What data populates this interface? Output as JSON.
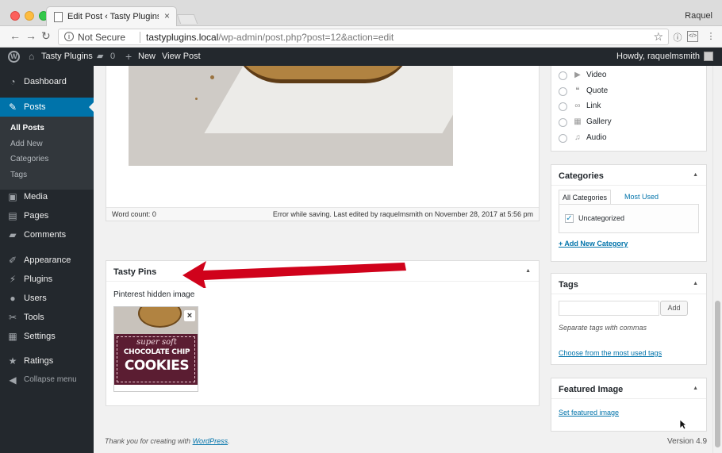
{
  "browser": {
    "tab_title": "Edit Post ‹ Tasty Plugins — Wo",
    "tab_close": "×",
    "profile_name": "Raquel",
    "security_label": "Not Secure",
    "url_host": "tastyplugins.local",
    "url_path": "/wp-admin/post.php?post=12&action=edit",
    "star_glyph": "☆"
  },
  "adminbar": {
    "site_name": "Tasty Plugins",
    "comment_count": "0",
    "new_label": "New",
    "view_post": "View Post",
    "howdy": "Howdy, raquelmsmith"
  },
  "sidebar": {
    "dashboard": "Dashboard",
    "posts": "Posts",
    "sub": {
      "all_posts": "All Posts",
      "add_new": "Add New",
      "categories": "Categories",
      "tags": "Tags"
    },
    "media": "Media",
    "pages": "Pages",
    "comments": "Comments",
    "appearance": "Appearance",
    "plugins": "Plugins",
    "users": "Users",
    "tools": "Tools",
    "settings": "Settings",
    "ratings": "Ratings",
    "collapse": "Collapse menu"
  },
  "editor": {
    "word_count": "Word count: 0",
    "status": "Error while saving. Last edited by raquelmsmith on November 28, 2017 at 5:56 pm"
  },
  "tasty_pins": {
    "title": "Tasty Pins",
    "label": "Pinterest hidden image",
    "image_line1": "super soft",
    "image_line2": "CHOCOLATE CHIP",
    "image_line3": "COOKIES",
    "remove_glyph": "×"
  },
  "format": {
    "options": [
      "Video",
      "Quote",
      "Link",
      "Gallery",
      "Audio"
    ]
  },
  "categories": {
    "title": "Categories",
    "tab_all": "All Categories",
    "tab_most": "Most Used",
    "item": "Uncategorized",
    "add_link": "+ Add New Category"
  },
  "tags": {
    "title": "Tags",
    "add_button": "Add",
    "hint": "Separate tags with commas",
    "choose_link": "Choose from the most used tags"
  },
  "featured": {
    "title": "Featured Image",
    "set_link": "Set featured image"
  },
  "footer": {
    "thanks_prefix": "Thank you for creating with ",
    "thanks_link": "WordPress",
    "thanks_suffix": ".",
    "version": "Version 4.9"
  },
  "colors": {
    "admin_dark": "#23282d",
    "accent_blue": "#0073aa",
    "arrow_red": "#d0021b"
  }
}
